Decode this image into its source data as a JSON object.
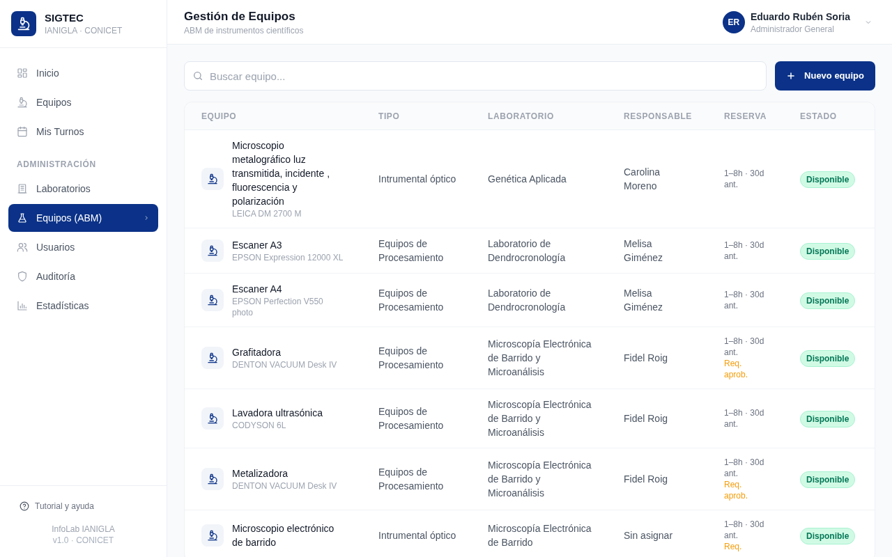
{
  "app": {
    "name": "SIGTEC",
    "subtitle": "IANIGLA · CONICET"
  },
  "sidebar": {
    "items": [
      {
        "label": "Inicio",
        "selected": false
      },
      {
        "label": "Equipos",
        "selected": false
      },
      {
        "label": "Mis Turnos",
        "selected": false
      }
    ],
    "section_title": "ADMINISTRACIÓN",
    "admin_items": [
      {
        "label": "Laboratorios",
        "selected": false
      },
      {
        "label": "Equipos (ABM)",
        "selected": true
      },
      {
        "label": "Usuarios",
        "selected": false
      },
      {
        "label": "Auditoría",
        "selected": false
      },
      {
        "label": "Estadísticas",
        "selected": false
      }
    ],
    "help": "Tutorial y ayuda",
    "footer_name": "InfoLab IANIGLA",
    "footer_version": "v1.0 · CONICET"
  },
  "header": {
    "title": "Gestión de Equipos",
    "subtitle": "ABM de instrumentos científicos",
    "user": {
      "initials": "ER",
      "name": "Eduardo Rubén Soria",
      "role": "Administrador General"
    }
  },
  "search": {
    "placeholder": "Buscar equipo..."
  },
  "new_button": "Nuevo equipo",
  "table": {
    "columns": [
      "EQUIPO",
      "TIPO",
      "LABORATORIO",
      "RESPONSABLE",
      "RESERVA",
      "ESTADO"
    ],
    "rows": [
      {
        "name": "Microscopio metalográfico luz transmitida, incidente , fluorescencia y polarización",
        "model": "LEICA DM 2700 M",
        "type": "Intrumental óptico",
        "lab": "Genética Aplicada",
        "responsible": "Carolina Moreno",
        "reserve": "1–8h · 30d ant.",
        "status": "Disponible"
      },
      {
        "name": "Escaner A3",
        "model": "EPSON Expression 12000 XL",
        "type": "Equipos de Procesamiento",
        "lab": "Laboratorio de Dendrocronología",
        "responsible": "Melisa Giménez",
        "reserve": "1–8h · 30d ant.",
        "status": "Disponible"
      },
      {
        "name": "Escaner A4",
        "model": "EPSON Perfection V550 photo",
        "type": "Equipos de Procesamiento",
        "lab": "Laboratorio de Dendrocronología",
        "responsible": "Melisa Giménez",
        "reserve": "1–8h · 30d ant.",
        "status": "Disponible"
      },
      {
        "name": "Grafitadora",
        "model": "DENTON VACUUM Desk IV",
        "type": "Equipos de Procesamiento",
        "lab": "Microscopía Electrónica de Barrido y Microanálisis",
        "responsible": "Fidel Roig",
        "reserve": "1–8h · 30d ant.",
        "approval": "Req. aprob.",
        "status": "Disponible"
      },
      {
        "name": "Lavadora ultrasónica",
        "model": "CODYSON 6L",
        "type": "Equipos de Procesamiento",
        "lab": "Microscopía Electrónica de Barrido y Microanálisis",
        "responsible": "Fidel Roig",
        "reserve": "1–8h · 30d ant.",
        "status": "Disponible"
      },
      {
        "name": "Metalizadora",
        "model": "DENTON VACUUM Desk IV",
        "type": "Equipos de Procesamiento",
        "lab": "Microscopía Electrónica de Barrido y Microanálisis",
        "responsible": "Fidel Roig",
        "reserve": "1–8h · 30d ant.",
        "approval": "Req. aprob.",
        "status": "Disponible"
      },
      {
        "name": "Microscopio electrónico de barrido",
        "type": "Intrumental óptico",
        "lab": "Microscopía Electrónica de Barrido",
        "responsible": "Sin asignar",
        "reserve": "1–8h · 30d ant.",
        "approval": "Req.",
        "status": "Disponible"
      }
    ]
  }
}
